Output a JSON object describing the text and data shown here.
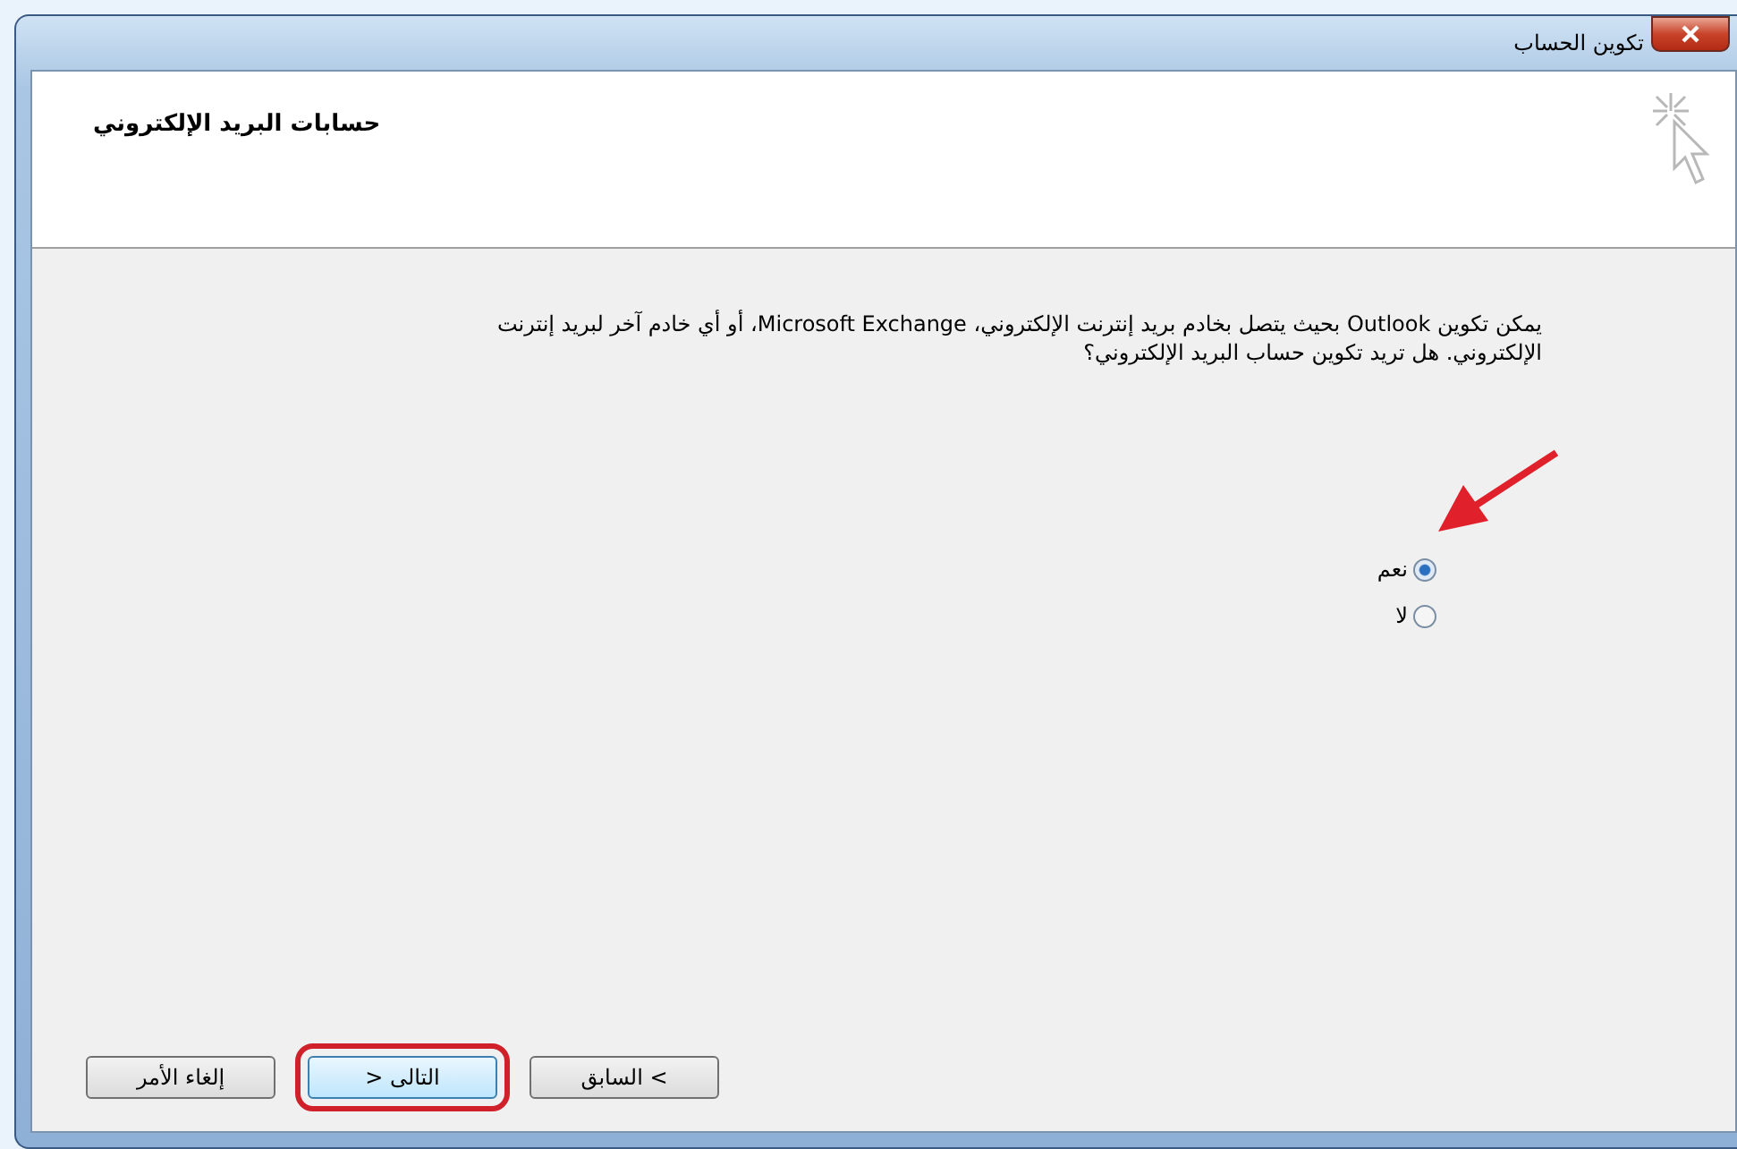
{
  "window": {
    "title": "تكوين الحساب"
  },
  "header": {
    "title": "حسابات البريد الإلكتروني"
  },
  "body": {
    "text": "يمكن تكوين Outlook بحيث يتصل بخادم بريد إنترنت الإلكتروني، Microsoft Exchange، أو أي خادم آخر لبريد إنترنت الإلكتروني. هل تريد تكوين حساب البريد الإلكتروني؟"
  },
  "options": [
    {
      "label": "نعم",
      "selected": true
    },
    {
      "label": "لا",
      "selected": false
    }
  ],
  "buttons": [
    {
      "label": "السابق <",
      "highlighted": false
    },
    {
      "label": "> التالى",
      "highlighted": true
    },
    {
      "label": "إلغاء الأمر",
      "highlighted": false
    }
  ]
}
